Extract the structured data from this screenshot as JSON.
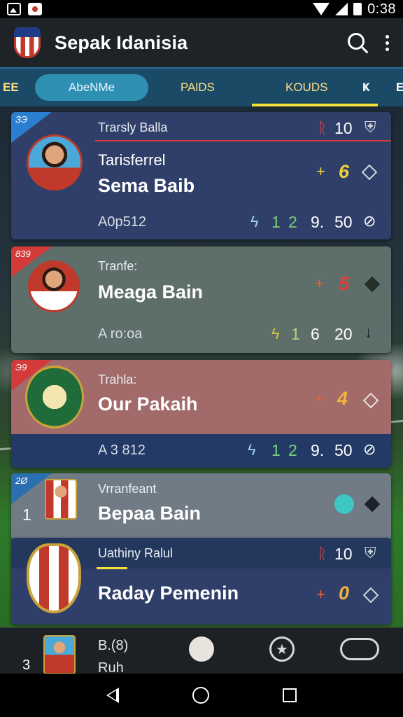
{
  "status_bar": {
    "time": "0:38"
  },
  "app_bar": {
    "title": "Sepak Idanisia"
  },
  "tabs": [
    {
      "label": "EE"
    },
    {
      "label": "AbeNMe",
      "active_pill": true
    },
    {
      "label": "PAlDS"
    },
    {
      "label": "KOUDS",
      "selected": true
    },
    {
      "label": "Ҝ"
    },
    {
      "label": "E"
    }
  ],
  "cards": [
    {
      "ribbon": "ЗЭ",
      "meta": "Trarsly Balla",
      "top_right_num": "10",
      "title": "Tarisferrel",
      "name": "Sema Baib",
      "code": "A0p512",
      "stat_a": "1",
      "stat_b": "2",
      "stat_c": "9.",
      "stat_d": "50",
      "big_value": "6",
      "color_theme": "#2f3f69"
    },
    {
      "ribbon": "839",
      "meta": "Tranfe:",
      "name": "Meaga Bain",
      "code": "A ro:oa",
      "stat_a": "1",
      "stat_c": "6",
      "stat_d": "20",
      "big_value": "5",
      "color_theme": "#5e6f6b"
    },
    {
      "ribbon": "Э9",
      "meta": "Trahla:",
      "name": "Our Pakaih",
      "code": "A 3 812",
      "stat_a": "1",
      "stat_b": "2",
      "stat_c": "9.",
      "stat_d": "50",
      "big_value": "4",
      "color_theme": "#a26a69"
    },
    {
      "ribbon": "2Ø",
      "rank": "1",
      "meta": "Vrranfeant",
      "name": "Bepaa Bain",
      "color_theme": "#707b86"
    },
    {
      "meta": "Uathiny Ralul",
      "top_right_num": "10",
      "name": "Raday Pemenin",
      "big_value": "0",
      "color_theme": "#2f3f69"
    }
  ],
  "bottom_strip": {
    "rank": "3",
    "label_top": "B.(8)",
    "label_bottom": "Ruh"
  }
}
